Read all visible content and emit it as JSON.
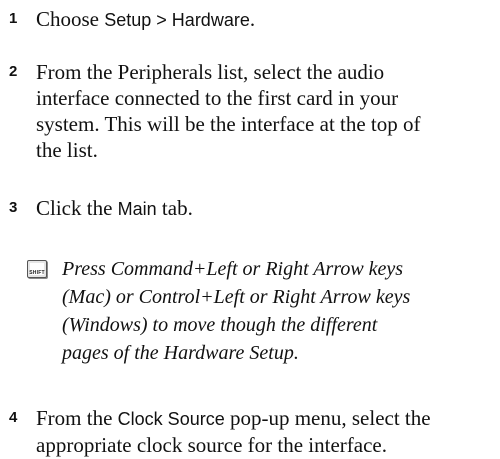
{
  "steps": [
    {
      "number": "1",
      "segments": [
        {
          "text": "Choose ",
          "style": "serif"
        },
        {
          "text": "Setup > Hardware",
          "style": "sans"
        },
        {
          "text": ".",
          "style": "serif"
        }
      ]
    },
    {
      "number": "2",
      "lines": [
        "From the Peripherals list, select the audio",
        "interface connected to the first card in your",
        "system. This will be the interface at the top of",
        "the list."
      ]
    },
    {
      "number": "3",
      "segments": [
        {
          "text": "Click the ",
          "style": "serif"
        },
        {
          "text": "Main",
          "style": "sans"
        },
        {
          "text": " tab.",
          "style": "serif"
        }
      ]
    },
    {
      "number": "4",
      "line1_segments": [
        {
          "text": "From the ",
          "style": "serif"
        },
        {
          "text": "Clock Source",
          "style": "sans"
        },
        {
          "text": " pop-up menu, select the",
          "style": "serif"
        }
      ],
      "line2": "appropriate clock source for the interface."
    }
  ],
  "note": {
    "icon": "shift-key-icon",
    "icon_label": "SHIFT",
    "lines": [
      "Press Command+Left or Right Arrow keys",
      "(Mac) or Control+Left or Right Arrow keys",
      "(Windows) to move though the different",
      "pages of the Hardware Setup."
    ]
  }
}
